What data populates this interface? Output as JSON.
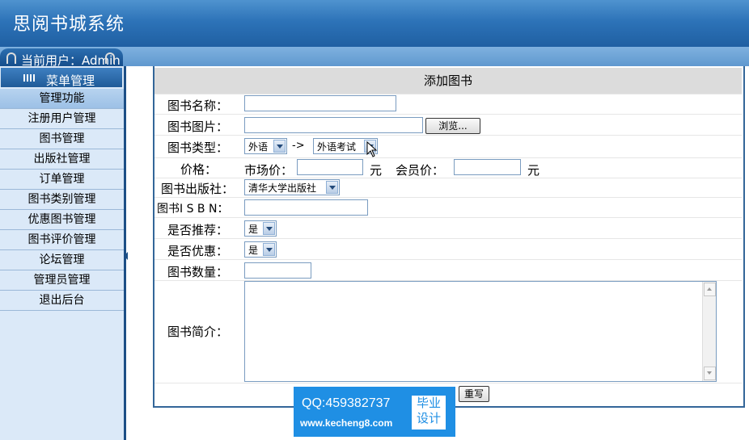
{
  "header": {
    "title": "思阅书城系统"
  },
  "userbar": {
    "current_user": "当前用户：Admin"
  },
  "sidebar": {
    "menu_title": "菜单管理",
    "items": [
      {
        "label": "管理功能",
        "type": "head"
      },
      {
        "label": "注册用户管理"
      },
      {
        "label": "图书管理"
      },
      {
        "label": "出版社管理"
      },
      {
        "label": "订单管理"
      },
      {
        "label": "图书类别管理"
      },
      {
        "label": "优惠图书管理"
      },
      {
        "label": "图书评价管理"
      },
      {
        "label": "论坛管理"
      },
      {
        "label": "管理员管理"
      },
      {
        "label": "退出后台"
      }
    ]
  },
  "form": {
    "title": "添加图书",
    "name_label": "图书名称：",
    "name_value": "",
    "image_label": "图书图片：",
    "image_value": "",
    "browse_button": "浏览...",
    "type_label": "图书类型：",
    "type_primary": "外语",
    "type_arrow": "->",
    "type_secondary": "外语考试",
    "price_label": "价格：",
    "market_price_label": "市场价：",
    "market_price_value": "",
    "currency_unit": "元",
    "member_price_label": "会员价：",
    "member_price_value": "",
    "currency_unit2": "元",
    "publisher_label": "图书出版社：",
    "publisher_value": "清华大学出版社",
    "isbn_label": "图书I S B N：",
    "isbn_value": "",
    "recommend_label": "是否推荐：",
    "recommend_value": "是",
    "discount_label": "是否优惠：",
    "discount_value": "是",
    "quantity_label": "图书数量：",
    "quantity_value": "",
    "intro_label": "图书简介：",
    "intro_value": "",
    "reset_button": "重写"
  },
  "watermark": {
    "qq": "QQ:459382737",
    "url": "www.kecheng8.com",
    "badge": "毕业设计"
  }
}
